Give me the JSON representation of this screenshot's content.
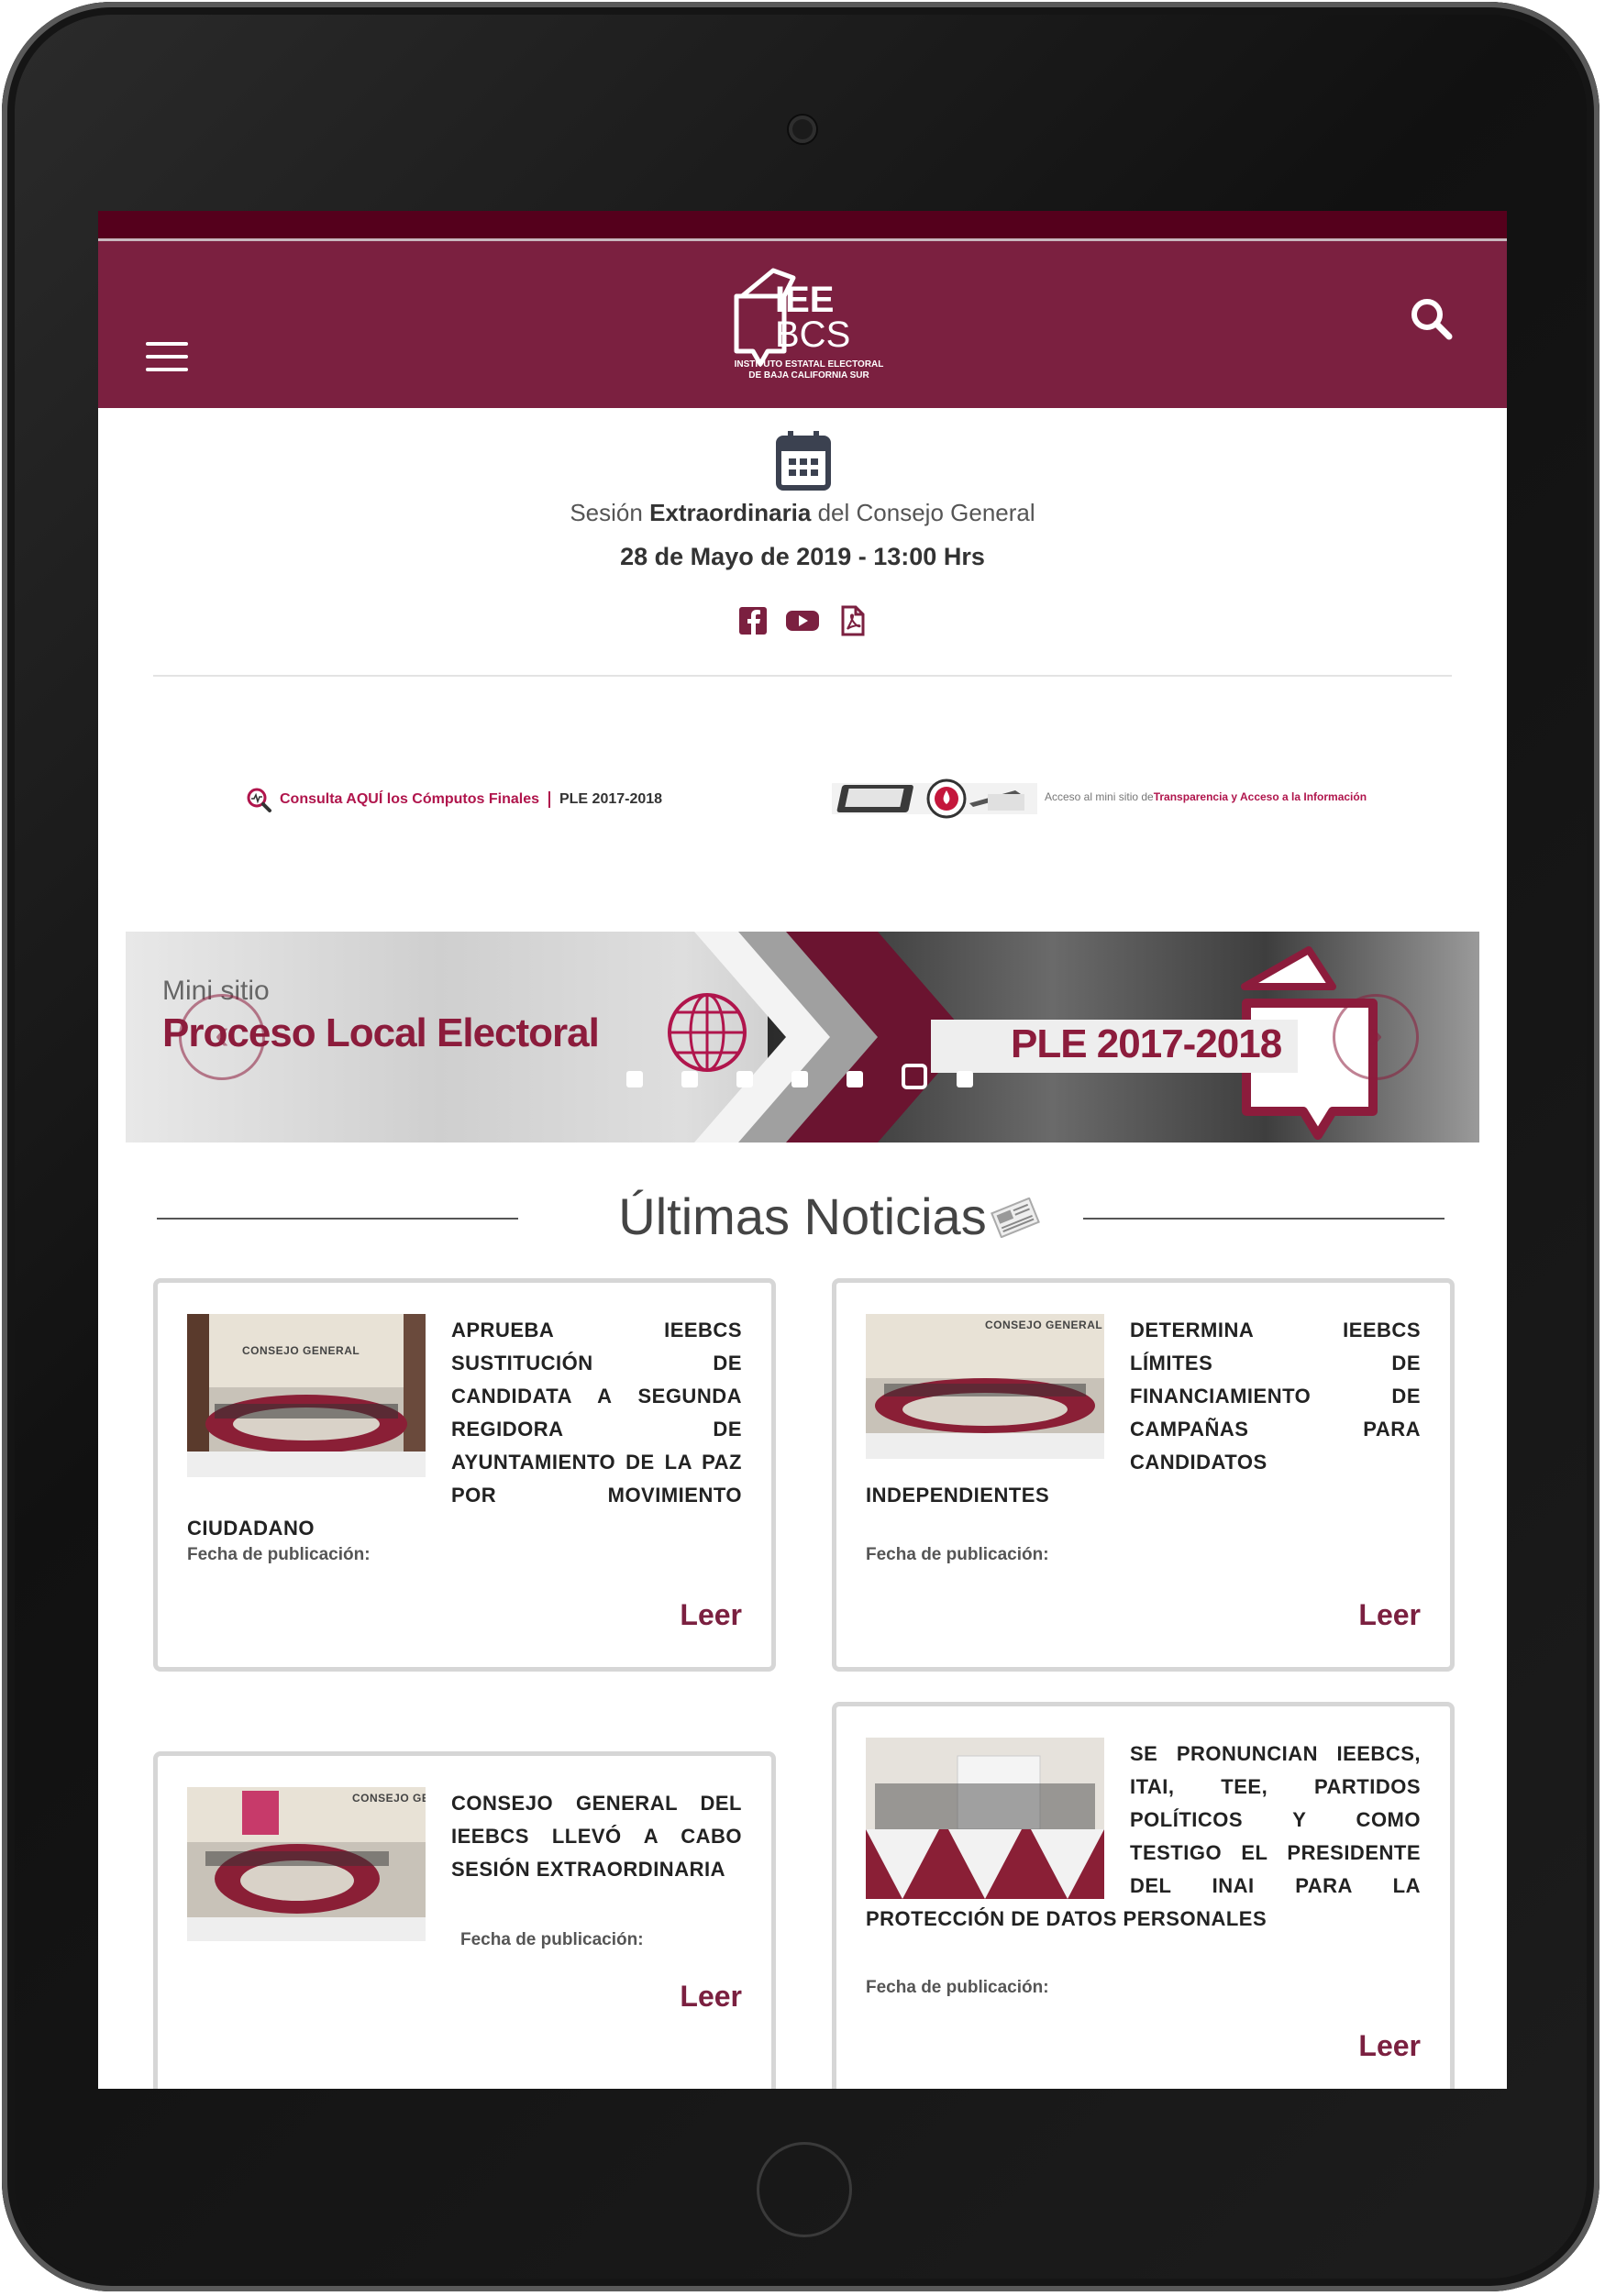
{
  "header": {
    "logo_main": "IEE",
    "logo_secondary": "BCS",
    "logo_sub_line1": "INSTITUTO ESTATAL ELECTORAL",
    "logo_sub_line2": "DE BAJA CALIFORNIA SUR",
    "brand_color": "#7b2040"
  },
  "session": {
    "title_prefix": "Sesión ",
    "title_bold": "Extraordinaria",
    "title_suffix": " del Consejo General",
    "date": "28 de Mayo de 2019 - 13:00 Hrs",
    "icons": [
      "facebook-icon",
      "youtube-icon",
      "pdf-icon"
    ]
  },
  "banners": {
    "consulta_link": "Consulta AQUÍ los Cómputos Finales",
    "consulta_ple": "PLE 2017-2018",
    "transparencia_prefix": "Acceso al mini sitio de ",
    "transparencia_link": "Transparencia y Acceso a la Información"
  },
  "slider": {
    "mini_label": "Mini sitio",
    "title": "Proceso Local Electoral",
    "ple_label": "PLE 2017-2018",
    "prev_symbol": "‹",
    "next_symbol": "›",
    "dot_count": 7,
    "active_index": 5
  },
  "news": {
    "title": "Últimas Noticias",
    "fecha_label": "Fecha de publicación:",
    "read_label": "Leer",
    "items": [
      {
        "text": "APRUEBA IEEBCS SUSTITUCIÓN DE CANDIDATA A SEGUNDA REGIDORA DE AYUNTAMIENTO DE LA PAZ POR MOVIMIENTO CIUDADANO"
      },
      {
        "text": "DETERMINA IEEBCS LÍMITES DE FINANCIAMIENTO DE CAMPAÑAS PARA CANDIDATOS INDEPENDIENTES"
      },
      {
        "text": "CONSEJO GENERAL DEL IEEBCS LLEVÓ A CABO SESIÓN EXTRAORDINARIA"
      },
      {
        "text": "SE PRONUNCIAN IEEBCS, ITAI, TEE, PARTIDOS POLÍTICOS Y COMO TESTIGO EL PRESIDENTE DEL INAI PARA LA PROTECCIÓN DE DATOS PERSONALES"
      }
    ]
  }
}
